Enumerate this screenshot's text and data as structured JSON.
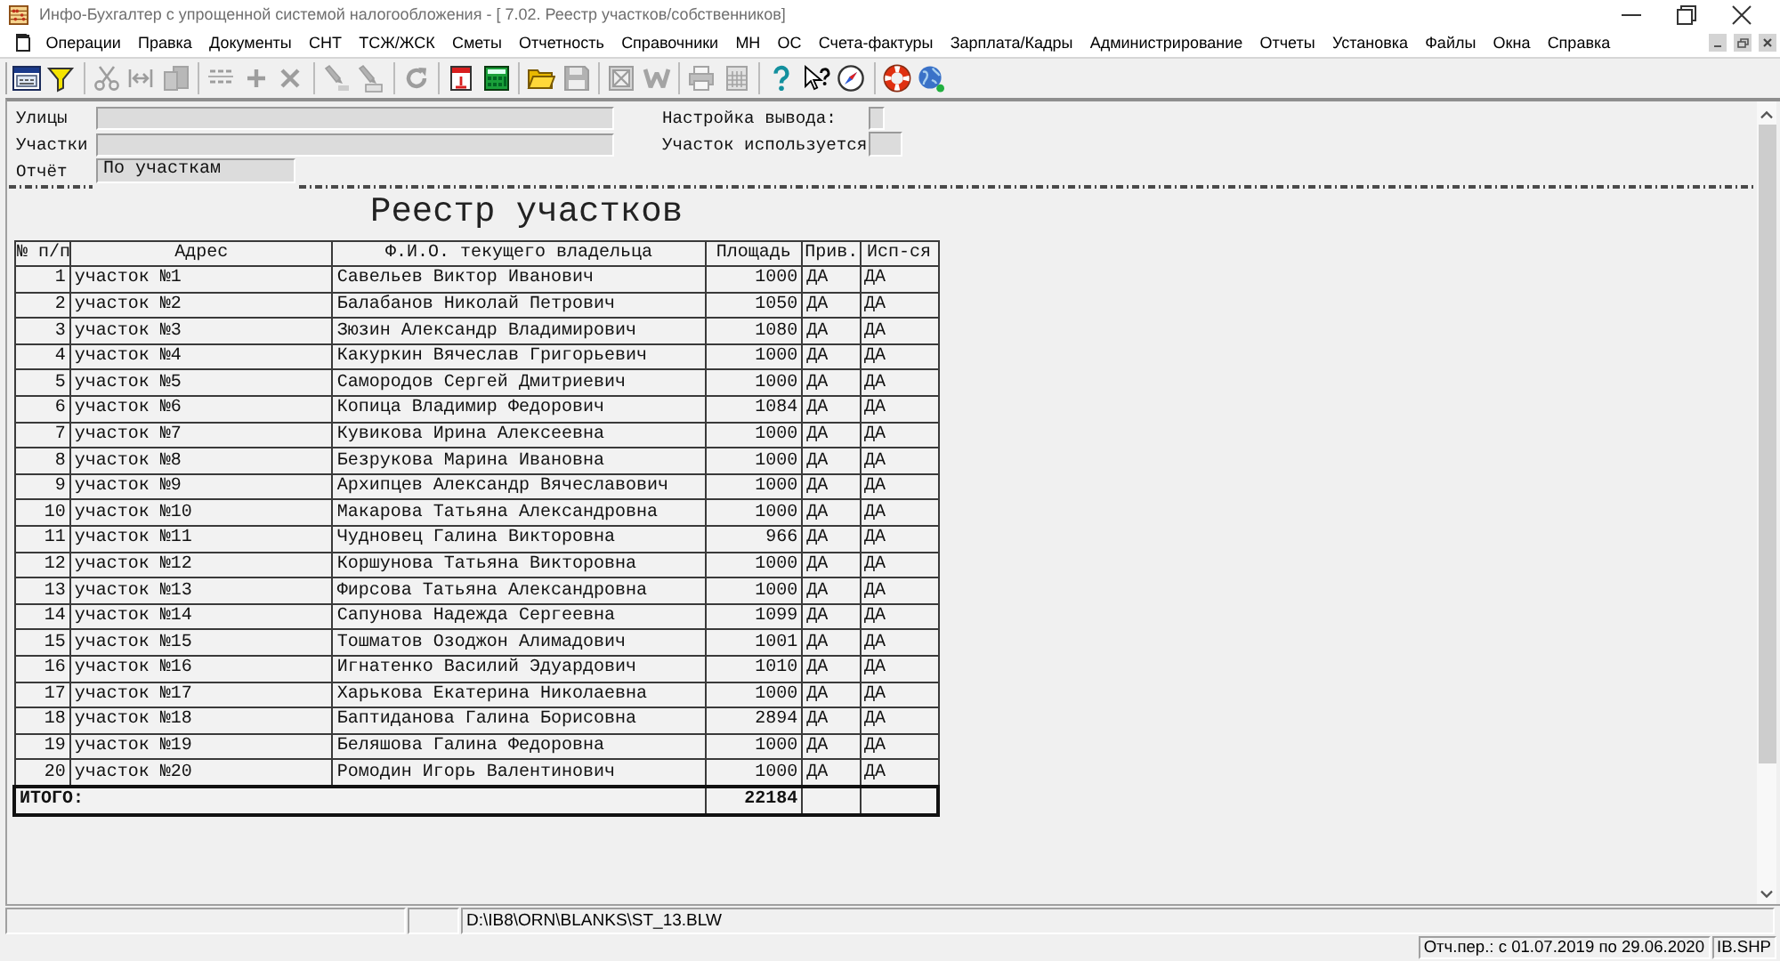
{
  "window": {
    "title": "Инфо-Бухгалтер с упрощенной системой налогообложения - [ 7.02. Реестр участков/собственников]"
  },
  "menu": [
    "Операции",
    "Правка",
    "Документы",
    "СНТ",
    "ТСЖ/ЖСК",
    "Сметы",
    "Отчетность",
    "Справочники",
    "МН",
    "ОС",
    "Счета-фактуры",
    "Зарплата/Кадры",
    "Администрирование",
    "Отчеты",
    "Установка",
    "Файлы",
    "Окна",
    "Справка"
  ],
  "toolbar": [
    {
      "buttons": [
        {
          "kind": "form",
          "disabled": false
        },
        {
          "kind": "filter",
          "disabled": false
        }
      ]
    },
    {
      "buttons": [
        {
          "kind": "cut",
          "disabled": true
        },
        {
          "kind": "merge",
          "disabled": true
        },
        {
          "kind": "copy",
          "disabled": true
        }
      ]
    },
    {
      "buttons": [
        {
          "kind": "numbering",
          "disabled": true
        },
        {
          "kind": "add",
          "disabled": true
        },
        {
          "kind": "delete",
          "disabled": true
        }
      ]
    },
    {
      "buttons": [
        {
          "kind": "marker",
          "disabled": true
        },
        {
          "kind": "highlight",
          "disabled": true
        }
      ]
    },
    {
      "buttons": [
        {
          "kind": "refresh",
          "disabled": true
        }
      ]
    },
    {
      "buttons": [
        {
          "kind": "calendar",
          "disabled": false
        },
        {
          "kind": "calculator",
          "disabled": false
        }
      ]
    },
    {
      "buttons": [
        {
          "kind": "open",
          "disabled": false
        },
        {
          "kind": "save",
          "disabled": true
        }
      ]
    },
    {
      "buttons": [
        {
          "kind": "image",
          "disabled": true
        },
        {
          "kind": "word",
          "disabled": true
        }
      ]
    },
    {
      "buttons": [
        {
          "kind": "print",
          "disabled": true
        },
        {
          "kind": "grid",
          "disabled": true
        }
      ]
    },
    {
      "buttons": [
        {
          "kind": "help",
          "disabled": false
        },
        {
          "kind": "pointer",
          "disabled": false
        },
        {
          "kind": "compass",
          "disabled": false
        }
      ]
    },
    {
      "buttons": [
        {
          "kind": "support",
          "disabled": false
        },
        {
          "kind": "web",
          "disabled": false
        }
      ]
    }
  ],
  "filters": [
    {
      "label": "Улицы",
      "kind": "lookup"
    },
    {
      "label": "Участки",
      "kind": "lookup"
    },
    {
      "label": "Отчёт",
      "kind": "choice",
      "value": "По участкам"
    }
  ],
  "options": [
    {
      "label": "Настройка вывода:",
      "kind": "narrow"
    },
    {
      "label": "Участок используется",
      "kind": "box"
    }
  ],
  "report": {
    "title": "Реестр участков",
    "columns": [
      "№ п/п",
      "Адрес",
      "Ф.И.О. текущего владельца",
      "Площадь",
      "Прив.",
      "Исп-ся"
    ],
    "rows": [
      [
        "1",
        "участок №1",
        "Савельев Виктор Иванович",
        "1000",
        "ДА",
        "ДА"
      ],
      [
        "2",
        "участок №2",
        "Балабанов Николай Петрович",
        "1050",
        "ДА",
        "ДА"
      ],
      [
        "3",
        "участок №3",
        "Зюзин Александр Владимирович",
        "1080",
        "ДА",
        "ДА"
      ],
      [
        "4",
        "участок №4",
        "Какуркин Вячеслав Григорьевич",
        "1000",
        "ДА",
        "ДА"
      ],
      [
        "5",
        "участок №5",
        "Самородов Сергей Дмитриевич",
        "1000",
        "ДА",
        "ДА"
      ],
      [
        "6",
        "участок №6",
        "Копица Владимир Федорович",
        "1084",
        "ДА",
        "ДА"
      ],
      [
        "7",
        "участок №7",
        "Кувикова Ирина Алексеевна",
        "1000",
        "ДА",
        "ДА"
      ],
      [
        "8",
        "участок №8",
        "Безрукова Марина Ивановна",
        "1000",
        "ДА",
        "ДА"
      ],
      [
        "9",
        "участок №9",
        "Архипцев Александр Вячеславович",
        "1000",
        "ДА",
        "ДА"
      ],
      [
        "10",
        "участок №10",
        "Макарова Татьяна Александровна",
        "1000",
        "ДА",
        "ДА"
      ],
      [
        "11",
        "участок №11",
        "Чудновец Галина Викторовна",
        "966",
        "ДА",
        "ДА"
      ],
      [
        "12",
        "участок №12",
        "Коршунова Татьяна Викторовна",
        "1000",
        "ДА",
        "ДА"
      ],
      [
        "13",
        "участок №13",
        "Фирсова Татьяна Александровна",
        "1000",
        "ДА",
        "ДА"
      ],
      [
        "14",
        "участок №14",
        "Сапунова Надежда Сергеевна",
        "1099",
        "ДА",
        "ДА"
      ],
      [
        "15",
        "участок №15",
        "Тошматов Озоджон Алимадович",
        "1001",
        "ДА",
        "ДА"
      ],
      [
        "16",
        "участок №16",
        "Игнатенко Василий Эдуардович",
        "1010",
        "ДА",
        "ДА"
      ],
      [
        "17",
        "участок №17",
        "Харькова Екатерина Николаевна",
        "1000",
        "ДА",
        "ДА"
      ],
      [
        "18",
        "участок №18",
        "Баптиданова Галина Борисовна",
        "2894",
        "ДА",
        "ДА"
      ],
      [
        "19",
        "участок №19",
        "Беляшова Галина Федоровна",
        "1000",
        "ДА",
        "ДА"
      ],
      [
        "20",
        "участок №20",
        "Ромодин Игорь Валентинович",
        "1000",
        "ДА",
        "ДА"
      ]
    ],
    "total": {
      "label": "ИТОГО:",
      "area": "22184"
    }
  },
  "status_bar": {
    "file": "D:\\IB8\\ORN\\BLANKS\\ST_13.BLW",
    "period": "Отч.пер.: с 01.07.2019 по 29.06.2020",
    "database": "IB.SHP"
  }
}
